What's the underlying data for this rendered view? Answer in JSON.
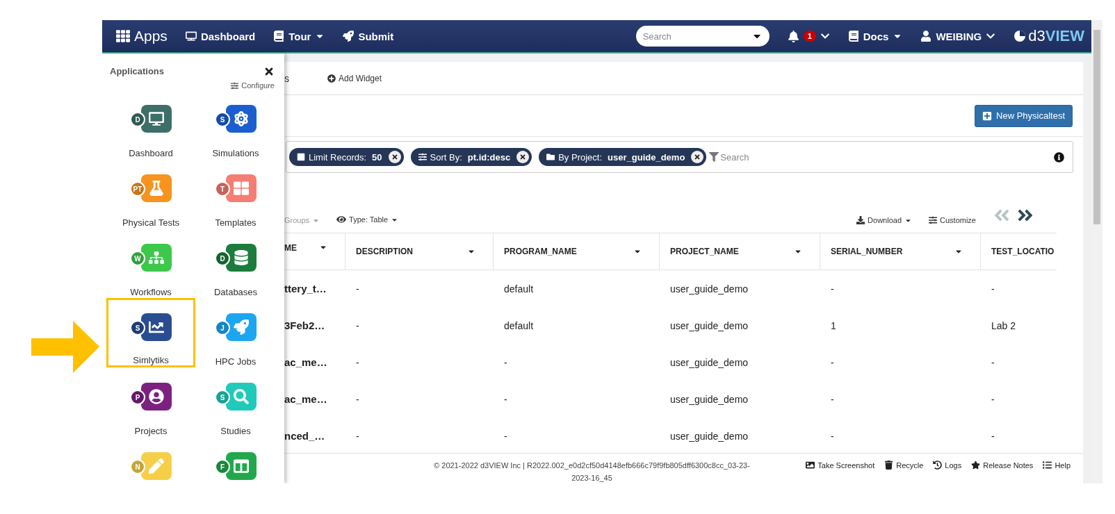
{
  "navbar": {
    "apps": "Apps",
    "items": [
      {
        "kind": "dashboard",
        "label": "Dashboard",
        "caret": false
      },
      {
        "kind": "tour",
        "label": "Tour",
        "caret": true
      },
      {
        "kind": "submit",
        "label": "Submit",
        "caret": false
      }
    ],
    "search": {
      "placeholder": "Search"
    },
    "notifications": "1",
    "docs": "Docs",
    "user": "WEIBING",
    "logo": [
      "d3",
      "VIEW"
    ]
  },
  "app_panel": {
    "title": "Applications",
    "configure": "Configure",
    "apps": [
      {
        "label": "Dashboard",
        "badge": "D",
        "kind": "desktop",
        "color": "#3d6f68",
        "highlighted": false
      },
      {
        "label": "Simulations",
        "badge": "S",
        "kind": "atom",
        "color": "#1c5ed0",
        "highlighted": false
      },
      {
        "label": "Physical Tests",
        "badge": "PT",
        "kind": "flask",
        "color": "#f7931e",
        "highlighted": false
      },
      {
        "label": "Templates",
        "badge": "T",
        "kind": "template",
        "color": "#f57d73",
        "highlighted": false
      },
      {
        "label": "Workflows",
        "badge": "W",
        "kind": "sitemap",
        "color": "#3cc84b",
        "highlighted": false
      },
      {
        "label": "Databases",
        "badge": "D",
        "kind": "database",
        "color": "#1b7c3c",
        "highlighted": false
      },
      {
        "label": "Simlytiks",
        "badge": "S",
        "kind": "chart",
        "color": "#2a4d92",
        "highlighted": true
      },
      {
        "label": "HPC Jobs",
        "badge": "J",
        "kind": "rocket",
        "color": "#1da6f0",
        "highlighted": false
      },
      {
        "label": "Projects",
        "badge": "P",
        "kind": "folder",
        "color": "#7c2180",
        "highlighted": false
      },
      {
        "label": "Studies",
        "badge": "S",
        "kind": "study",
        "color": "#1fcabb",
        "highlighted": false
      },
      {
        "badge": "N",
        "kind": "note",
        "color": "#f6cf48",
        "highlighted": false
      },
      {
        "badge": "F",
        "kind": "columns",
        "color": "#22a84c",
        "highlighted": false
      }
    ]
  },
  "tabs": {
    "cut_tab": "s",
    "add_widget": "Add Widget"
  },
  "new_button": "New Physicaltest",
  "filters": [
    {
      "kind": "limit",
      "label": "Limit Records:",
      "value": "50"
    },
    {
      "kind": "sort",
      "label": "Sort By:",
      "value": "pt.id:desc"
    },
    {
      "kind": "project",
      "label": "By Project:",
      "value": "user_guide_demo"
    }
  ],
  "filter_search": {
    "placeholder": "Search"
  },
  "view_toolbar": {
    "groups": "Groups",
    "type": "Type: Table",
    "download": "Download",
    "customize": "Customize",
    "previous": {
      "disabled": true
    },
    "next": {
      "disabled": false
    }
  },
  "table": {
    "columns": [
      "ME",
      "DESCRIPTION",
      "PROGRAM_NAME",
      "PROJECT_NAME",
      "SERIAL_NUMBER",
      "TEST_LOCATIO"
    ],
    "rows": [
      [
        "ttery_t…",
        "-",
        "default",
        "user_guide_demo",
        "-",
        "-"
      ],
      [
        "3Feb2…",
        "-",
        "default",
        "user_guide_demo",
        "1",
        "Lab 2"
      ],
      [
        "ac_me…",
        "-",
        "-",
        "user_guide_demo",
        "-",
        "-"
      ],
      [
        "ac_me…",
        "-",
        "-",
        "user_guide_demo",
        "-",
        "-"
      ],
      [
        "nced_…",
        "-",
        "-",
        "user_guide_demo",
        "-",
        "-"
      ]
    ]
  },
  "footer": {
    "copyright": "© 2021-2022 d3VIEW Inc | R2022.002_e0d2cf50d4148efb666c79f9fb805dff6300c8cc_03-23-2023-16_45",
    "links": [
      {
        "kind": "screenshot",
        "label": "Take Screenshot"
      },
      {
        "kind": "recycle",
        "label": "Recycle"
      },
      {
        "kind": "logs",
        "label": "Logs"
      },
      {
        "kind": "notes",
        "label": "Release Notes"
      },
      {
        "kind": "help",
        "label": "Help"
      }
    ]
  }
}
